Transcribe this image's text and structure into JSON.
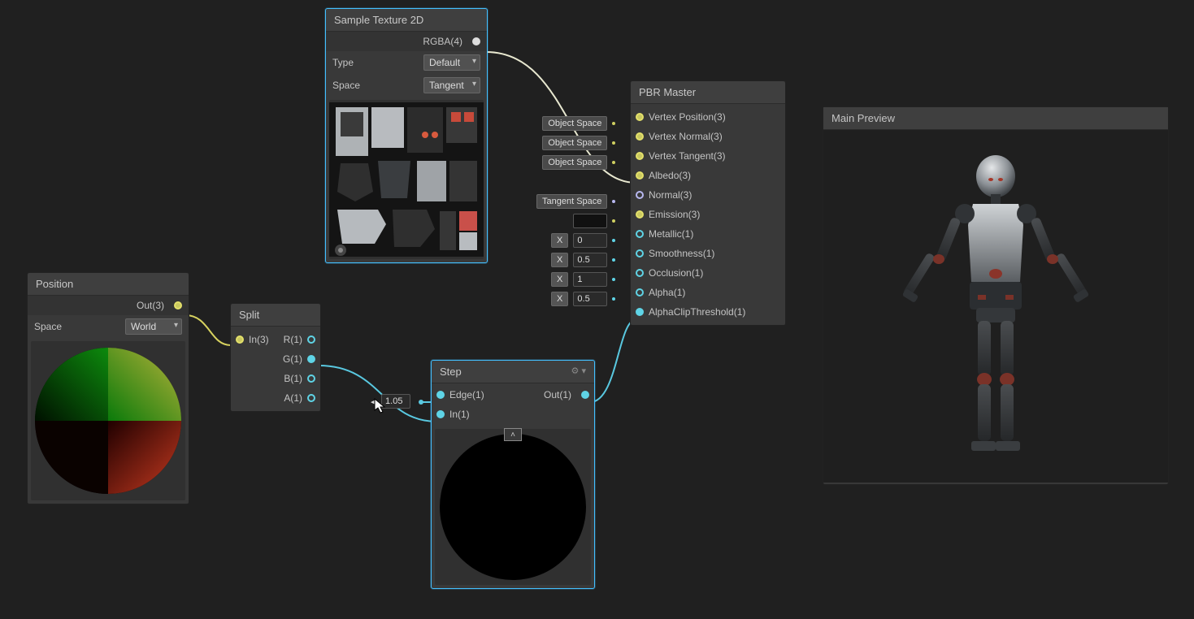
{
  "nodes": {
    "sampleTexture": {
      "title": "Sample Texture 2D",
      "out_rgba": "RGBA(4)",
      "type_label": "Type",
      "type_value": "Default",
      "space_label": "Space",
      "space_value": "Tangent"
    },
    "position": {
      "title": "Position",
      "out": "Out(3)",
      "space_label": "Space",
      "space_value": "World"
    },
    "split": {
      "title": "Split",
      "in": "In(3)",
      "r": "R(1)",
      "g": "G(1)",
      "b": "B(1)",
      "a": "A(1)"
    },
    "step": {
      "title": "Step",
      "edge": "Edge(1)",
      "edge_val": "1.05",
      "in": "In(1)",
      "out": "Out(1)"
    },
    "pbr": {
      "title": "PBR Master",
      "badges": {
        "os1": "Object Space",
        "os2": "Object Space",
        "os3": "Object Space",
        "ts": "Tangent Space"
      },
      "ports": {
        "vertexPos": "Vertex Position(3)",
        "vertexNorm": "Vertex Normal(3)",
        "vertexTan": "Vertex Tangent(3)",
        "albedo": "Albedo(3)",
        "normal": "Normal(3)",
        "emission": "Emission(3)",
        "metallic": "Metallic(1)",
        "smooth": "Smoothness(1)",
        "occlusion": "Occlusion(1)",
        "alpha": "Alpha(1)",
        "clip": "AlphaClipThreshold(1)"
      },
      "vals": {
        "metallic_x": "X",
        "metallic_v": "0",
        "smooth_x": "X",
        "smooth_v": "0.5",
        "occ_x": "X",
        "occ_v": "1",
        "alpha_x": "X",
        "alpha_v": "0.5"
      }
    }
  },
  "mainPreview": {
    "title": "Main Preview"
  }
}
